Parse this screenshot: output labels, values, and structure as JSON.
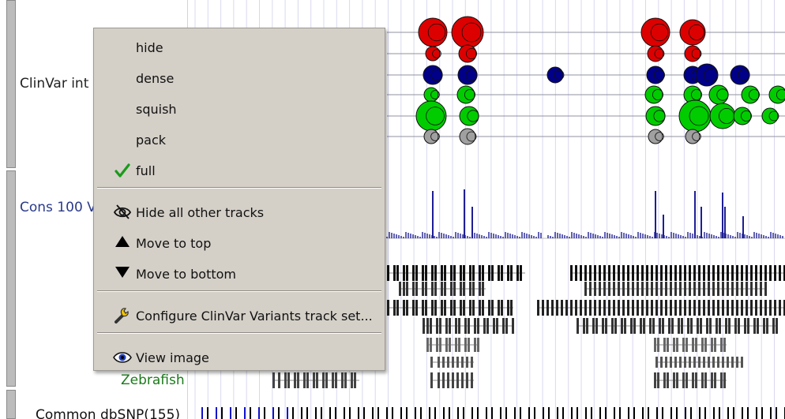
{
  "track_labels": {
    "clinvar": "ClinVar int",
    "cons": "Cons 100 V",
    "zebrafish": "Zebrafish",
    "dbsnp": "Common dbSNP(155)"
  },
  "colors": {
    "pathogenic": "#dd0000",
    "vus": "#000088",
    "benign": "#00cc00",
    "other": "#a0a0a0",
    "cons_plot": "#1e1e96",
    "zebrafish_label": "#1a7a1a",
    "cons_label": "#2a3a8a",
    "menu_bg": "#d4d0c8",
    "check": "#1a9a1a"
  },
  "context_menu": {
    "items": [
      {
        "label": "hide",
        "icon": ""
      },
      {
        "label": "dense",
        "icon": ""
      },
      {
        "label": "squish",
        "icon": ""
      },
      {
        "label": "pack",
        "icon": ""
      },
      {
        "label": "full",
        "icon": "check-icon"
      },
      {
        "label": "Hide all other tracks",
        "icon": "eye-slash-icon"
      },
      {
        "label": "Move to top",
        "icon": "triangle-up-icon"
      },
      {
        "label": "Move to bottom",
        "icon": "triangle-down-icon"
      },
      {
        "label": "Configure ClinVar Variants track set...",
        "icon": "wrench-icon"
      },
      {
        "label": "View image",
        "icon": "eye-icon"
      }
    ]
  }
}
